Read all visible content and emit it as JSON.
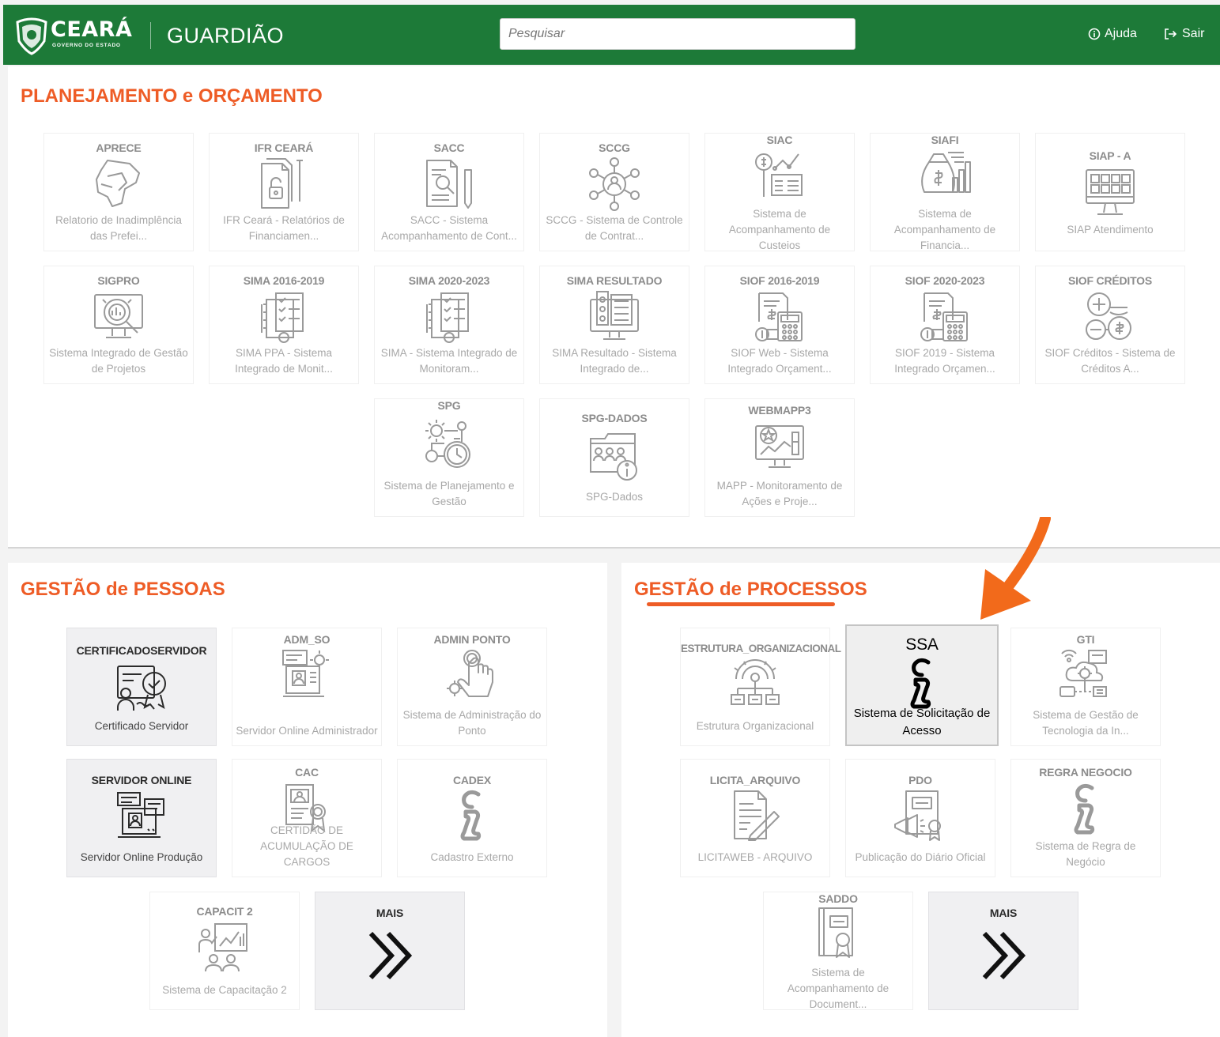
{
  "header": {
    "brand": "CEARÁ",
    "brand_sub": "GOVERNO DO ESTADO",
    "app_name": "GUARDIÃO",
    "search_placeholder": "Pesquisar",
    "help_label": "Ajuda",
    "exit_label": "Sair",
    "color": "#1d7a38"
  },
  "sections": {
    "planejamento": {
      "title": "PLANEJAMENTO e ORÇAMENTO",
      "tiles": [
        {
          "title": "APRECE",
          "desc": "Relatorio de Inadimplência das Prefei...",
          "icon": "map-icon"
        },
        {
          "title": "IFR CEARÁ",
          "desc": "IFR Ceará - Relatórios de Financiamen...",
          "icon": "document-lock-icon"
        },
        {
          "title": "SACC",
          "desc": "SACC - Sistema Acompanhamento de Cont...",
          "icon": "document-search-icon"
        },
        {
          "title": "SCCG",
          "desc": "SCCG - Sistema de Controle de Contrat...",
          "icon": "network-people-icon"
        },
        {
          "title": "SIAC",
          "desc": "Sistema de Acompanhamento de Custeios",
          "icon": "finance-chart-icon"
        },
        {
          "title": "SIAFI",
          "desc": "Sistema de Acompanhamento de Financia...",
          "icon": "money-bag-chart-icon"
        },
        {
          "title": "SIAP - A",
          "desc": "SIAP Atendimento",
          "icon": "monitor-grid-icon"
        },
        {
          "title": "SIGPRO",
          "desc": "Sistema Integrado de Gestão de Projetos",
          "icon": "chart-magnifier-icon"
        },
        {
          "title": "SIMA 2016-2019",
          "desc": "SIMA PPA - Sistema Integrado de Monit...",
          "icon": "checklist-icon"
        },
        {
          "title": "SIMA 2020-2023",
          "desc": "SIMA - Sistema Integrado de Monitoram...",
          "icon": "checklist-icon"
        },
        {
          "title": "SIMA RESULTADO",
          "desc": "SIMA Resultado - Sistema Integrado de...",
          "icon": "monitor-checklist-icon"
        },
        {
          "title": "SIOF 2016-2019",
          "desc": "SIOF Web - Sistema Integrado Orçament...",
          "icon": "calculator-invoice-icon"
        },
        {
          "title": "SIOF 2020-2023",
          "desc": "SIOF 2019 - Sistema Integrado Orçamen...",
          "icon": "calculator-invoice-icon"
        },
        {
          "title": "SIOF CRÉDITOS",
          "desc": "SIOF Créditos - Sistema de Créditos A...",
          "icon": "coins-plus-minus-icon"
        },
        {
          "title": "SPG",
          "desc": "Sistema de Planejamento e Gestão",
          "icon": "gear-stopwatch-icon"
        },
        {
          "title": "SPG-DADOS",
          "desc": "SPG-Dados",
          "icon": "folder-info-icon"
        },
        {
          "title": "WEBMAPP3",
          "desc": "MAPP - Monitoramento de Ações e Proje...",
          "icon": "monitor-star-chart-icon"
        }
      ]
    },
    "pessoas": {
      "title": "GESTÃO de PESSOAS",
      "tiles": [
        {
          "title": "CERTIFICADOSERVIDOR",
          "desc": "Certificado Servidor",
          "icon": "certificate-icon",
          "active": true
        },
        {
          "title": "ADM_SO",
          "desc": "Servidor Online Administrador",
          "icon": "monitor-user-gear-icon"
        },
        {
          "title": "ADMIN PONTO",
          "desc": "Sistema de Administração do Ponto",
          "icon": "hand-touch-icon"
        },
        {
          "title": "SERVIDOR ONLINE",
          "desc": "Servidor Online Produção",
          "icon": "monitor-user-icon",
          "active": true
        },
        {
          "title": "CAC",
          "desc": "CERTIDÃO DE ACUMULAÇÃO DE CARGOS",
          "icon": "id-card-badge-icon"
        },
        {
          "title": "CADEX",
          "desc": "Cadastro Externo",
          "icon": "info-icon"
        },
        {
          "title": "CAPACIT 2",
          "desc": "Sistema de Capacitação 2",
          "icon": "training-icon"
        },
        {
          "title": "MAIS",
          "desc": "",
          "icon": "double-chevron-right-icon",
          "active": true
        }
      ]
    },
    "processos": {
      "title": "GESTÃO de PROCESSOS",
      "tiles": [
        {
          "title": "ESTRUTURA_ORGANIZACIONAL",
          "desc": "Estrutura Organizacional",
          "icon": "org-structure-icon"
        },
        {
          "title": "SSA",
          "desc": "Sistema de Solicitação de Acesso",
          "icon": "info-icon",
          "highlight": true
        },
        {
          "title": "GTI",
          "desc": "Sistema de Gestão de Tecnologia da In...",
          "icon": "cloud-network-icon"
        },
        {
          "title": "LICITA_ARQUIVO",
          "desc": "LICITAWEB - ARQUIVO",
          "icon": "document-pen-icon"
        },
        {
          "title": "PDO",
          "desc": "Publicação do Diário Oficial",
          "icon": "megaphone-document-icon"
        },
        {
          "title": "REGRA NEGOCIO",
          "desc": "Sistema de Regra de Negócio",
          "icon": "info-icon"
        },
        {
          "title": "SADDO",
          "desc": "Sistema de Acompanhamento de Document...",
          "icon": "document-badge-icon"
        },
        {
          "title": "MAIS",
          "desc": "",
          "icon": "double-chevron-right-icon",
          "active": true
        }
      ]
    }
  },
  "accent_color": "#ee5c26"
}
